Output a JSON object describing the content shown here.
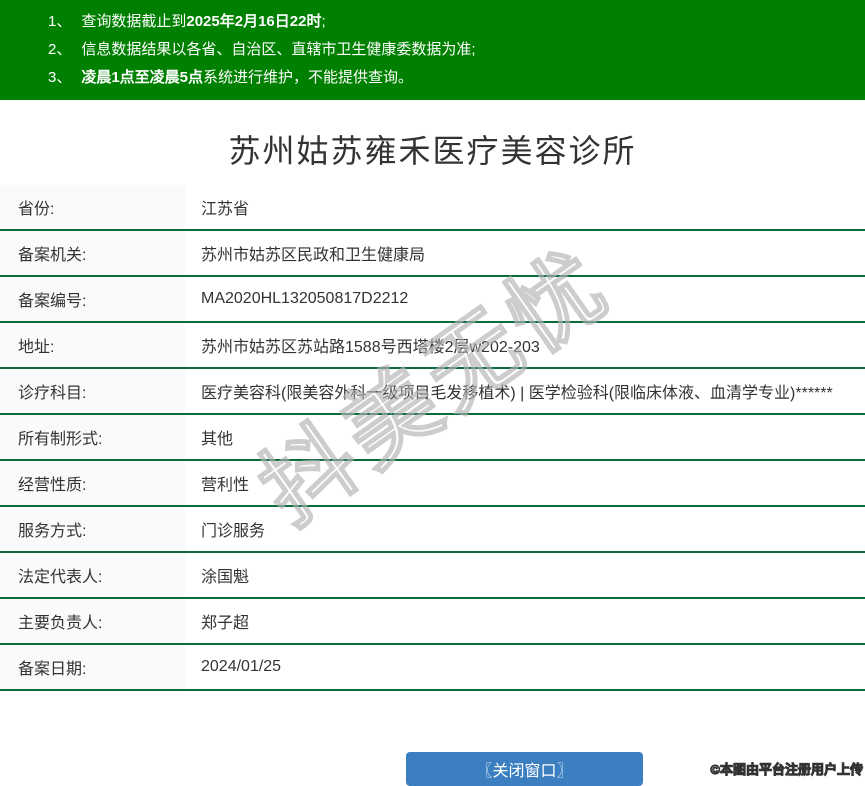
{
  "notice": {
    "bg_color": "#008000",
    "lines": [
      {
        "num": "1、",
        "pre": "查询数据截止到",
        "bold": "2025年2月16日22时",
        "post": ";"
      },
      {
        "num": "2、",
        "pre": "信息数据结果以各省、自治区、直辖市卫生健康委数据为准;",
        "bold": "",
        "post": ""
      },
      {
        "num": "3、",
        "pre": "",
        "bold": "凌晨1点至凌晨5点",
        "post": "系统进行维护，不能提供查询。"
      }
    ]
  },
  "page": {
    "title": "苏州姑苏雍禾医疗美容诊所"
  },
  "table": {
    "separator_color": "#0a6b3d",
    "label_bg_color": "#fafafa",
    "rows": [
      {
        "label": "省份:",
        "value": "江苏省"
      },
      {
        "label": "备案机关:",
        "value": "苏州市姑苏区民政和卫生健康局"
      },
      {
        "label": "备案编号:",
        "value": "MA2020HL132050817D2212"
      },
      {
        "label": "地址:",
        "value": "苏州市姑苏区苏站路1588号西塔楼2层w202-203"
      },
      {
        "label": "诊疗科目:",
        "value": "医疗美容科(限美容外科一级项目毛发移植术) | 医学检验科(限临床体液、血清学专业)******"
      },
      {
        "label": "所有制形式:",
        "value": "其他"
      },
      {
        "label": "经营性质:",
        "value": "营利性"
      },
      {
        "label": "服务方式:",
        "value": "门诊服务"
      },
      {
        "label": "法定代表人:",
        "value": "涂国魁"
      },
      {
        "label": "主要负责人:",
        "value": "郑子超"
      },
      {
        "label": "备案日期:",
        "value": "2024/01/25"
      }
    ]
  },
  "watermark": {
    "text": "抖美无忧"
  },
  "footer": {
    "close_button_label": "〖关闭窗口〗",
    "button_color": "#3b7fc0",
    "copyright": "©本图由平台注册用户上传"
  }
}
